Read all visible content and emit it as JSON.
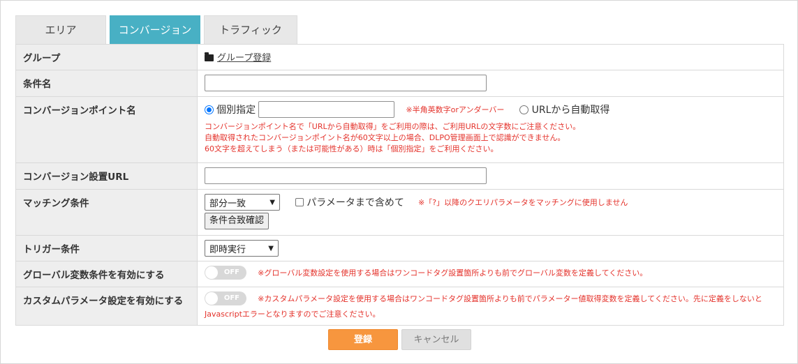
{
  "tabs": [
    {
      "label": "エリア",
      "active": false
    },
    {
      "label": "コンバージョン",
      "active": true
    },
    {
      "label": "トラフィック",
      "active": false
    }
  ],
  "rows": {
    "group": {
      "label": "グループ",
      "link": "グループ登録",
      "icon": "folder-icon"
    },
    "condition_name": {
      "label": "条件名",
      "value": ""
    },
    "cv_point": {
      "label": "コンバージョンポイント名",
      "radio_individual": "個別指定",
      "value": "",
      "hint": "※半角英数字orアンダーバー",
      "radio_auto": "URLから自動取得",
      "notes": [
        "コンバージョンポイント名で「URLから自動取得」をご利用の際は、ご利用URLの文字数にご注意ください。",
        "自動取得されたコンバージョンポイント名が60文字以上の場合、DLPO管理画面上で認識ができません。",
        "60文字を超えてしまう（または可能性がある）時は「個別指定」をご利用ください。"
      ]
    },
    "cv_url": {
      "label": "コンバージョン設置URL",
      "value": ""
    },
    "matching": {
      "label": "マッチング条件",
      "select_value": "部分一致",
      "checkbox_label": "パラメータまで含めて",
      "hint": "※「?」以降のクエリパラメータをマッチングに使用しません",
      "check_button": "条件合致確認"
    },
    "trigger": {
      "label": "トリガー条件",
      "select_value": "即時実行"
    },
    "global_var": {
      "label": "グローバル変数条件を有効にする",
      "toggle": "OFF",
      "note": "※グローバル変数設定を使用する場合はワンコードタグ設置箇所よりも前でグローバル変数を定義してください。"
    },
    "custom_param": {
      "label": "カスタムパラメータ設定を有効にする",
      "toggle": "OFF",
      "note_line1": "※カスタムパラメータ設定を使用する場合はワンコードタグ設置箇所よりも前でパラメーター値取得変数を定義してください。先に定義をしないと",
      "note_line2": "Javascriptエラーとなりますのでご注意ください。"
    }
  },
  "buttons": {
    "submit": "登録",
    "cancel": "キャンセル"
  },
  "colors": {
    "tab_active": "#48b0c4",
    "primary": "#f7963e",
    "warning_text": "#e4322b"
  }
}
